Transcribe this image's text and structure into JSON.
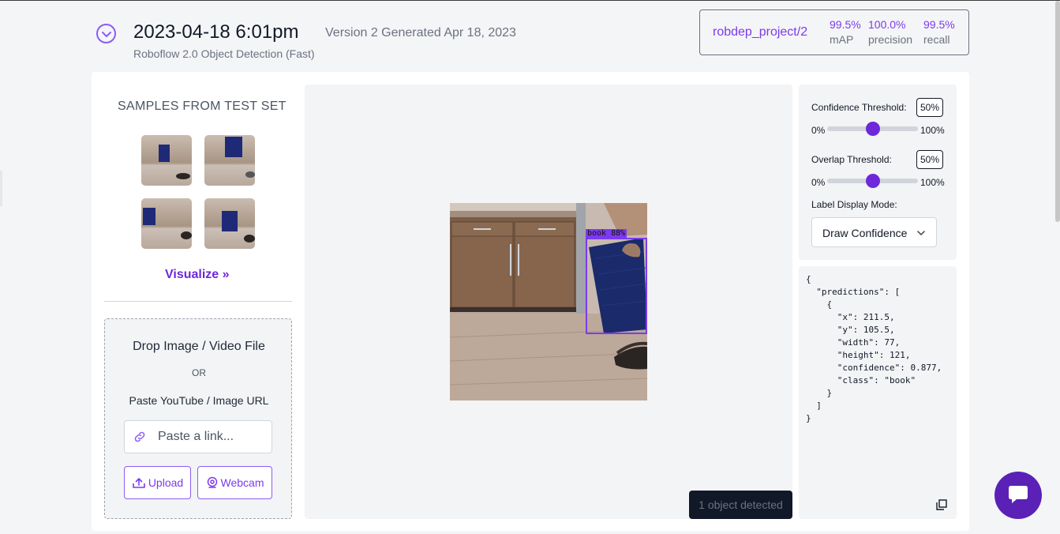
{
  "header": {
    "title": "2023-04-18 6:01pm",
    "version_text": "Version 2 Generated Apr 18, 2023",
    "model_type": "Roboflow 2.0 Object Detection (Fast)"
  },
  "metrics": {
    "project": "robdep_project/2",
    "map_value": "99.5%",
    "map_label": "mAP",
    "precision_value": "100.0%",
    "precision_label": "precision",
    "recall_value": "99.5%",
    "recall_label": "recall"
  },
  "samples": {
    "title": "SAMPLES FROM TEST SET",
    "visualize_label": "Visualize »"
  },
  "upload": {
    "drop_title": "Drop Image / Video File",
    "or_text": "OR",
    "paste_text": "Paste YouTube / Image URL",
    "link_placeholder": "Paste a link...",
    "upload_label": "Upload",
    "webcam_label": "Webcam"
  },
  "preview": {
    "detection_label": "book 88%",
    "detected_count_text": "1 object detected"
  },
  "controls": {
    "confidence_label": "Confidence Threshold:",
    "confidence_value": "50%",
    "confidence_fraction": 0.5,
    "overlap_label": "Overlap Threshold:",
    "overlap_value": "50%",
    "overlap_fraction": 0.5,
    "range_min": "0%",
    "range_max": "100%",
    "label_mode_label": "Label Display Mode:",
    "label_mode_value": "Draw Confidence"
  },
  "json_output": "{\n  \"predictions\": [\n    {\n      \"x\": 211.5,\n      \"y\": 105.5,\n      \"width\": 77,\n      \"height\": 121,\n      \"confidence\": 0.877,\n      \"class\": \"book\"\n    }\n  ]\n}",
  "colors": {
    "accent": "#7c3aed",
    "accent_dark": "#5b21b6",
    "page_bg": "#f4f5f7"
  },
  "icons": {
    "collapse": "chevron-down-circle-icon",
    "link": "link-icon",
    "upload": "upload-icon",
    "webcam": "webcam-icon",
    "copy": "copy-icon",
    "chat": "chat-icon"
  }
}
